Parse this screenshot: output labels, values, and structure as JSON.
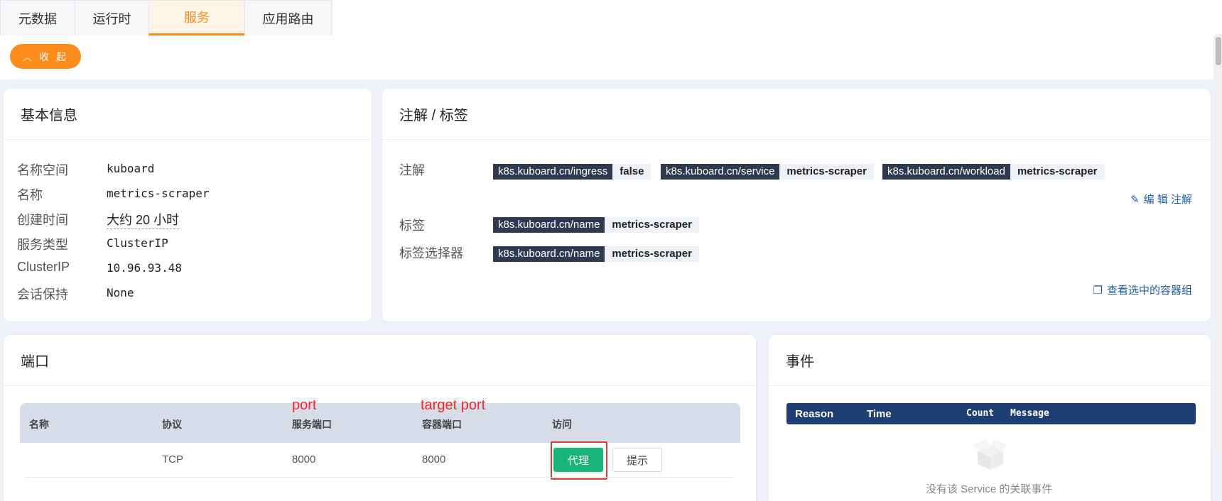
{
  "tabs": [
    {
      "label": "元数据"
    },
    {
      "label": "运行时"
    },
    {
      "label": "服务"
    },
    {
      "label": "应用路由"
    }
  ],
  "toolbar": {
    "collapse_label": "收 起",
    "collapse_icon": "chevron-up-icon"
  },
  "basic_info": {
    "title": "基本信息",
    "rows": [
      {
        "key": "名称空间",
        "value": "kuboard"
      },
      {
        "key": "名称",
        "value": "metrics-scraper"
      },
      {
        "key": "创建时间",
        "value": "大约 20 小时"
      },
      {
        "key": "服务类型",
        "value": "ClusterIP"
      },
      {
        "key": "ClusterIP",
        "value": "10.96.93.48"
      },
      {
        "key": "会话保持",
        "value": "None"
      }
    ]
  },
  "annotations": {
    "title": "注解 / 标签",
    "annotations_label": "注解",
    "labels_label": "标签",
    "selector_label": "标签选择器",
    "annotations": [
      {
        "key": "k8s.kuboard.cn/ingress",
        "value": "false"
      },
      {
        "key": "k8s.kuboard.cn/service",
        "value": "metrics-scraper"
      },
      {
        "key": "k8s.kuboard.cn/workload",
        "value": "metrics-scraper"
      }
    ],
    "labels": [
      {
        "key": "k8s.kuboard.cn/name",
        "value": "metrics-scraper"
      }
    ],
    "selectors": [
      {
        "key": "k8s.kuboard.cn/name",
        "value": "metrics-scraper"
      }
    ],
    "edit_link": "编 辑 注解",
    "view_pods_link": "查看选中的容器组"
  },
  "ports": {
    "title": "端口",
    "columns": [
      "名称",
      "协议",
      "服务端口",
      "容器端口",
      "访问"
    ],
    "rows": [
      {
        "name": "",
        "protocol": "TCP",
        "port": "8000",
        "target_port": "8000"
      }
    ],
    "proxy_label": "代理",
    "hint_label": "提示",
    "annotation_port": "port",
    "annotation_target_port": "target port"
  },
  "events": {
    "title": "事件",
    "columns": [
      "Reason",
      "Time",
      "Count",
      "Message"
    ],
    "empty_text": "没有该 Service 的关联事件"
  },
  "colors": {
    "accent": "#ff8c1a",
    "tag_key_bg": "#2e3a4f",
    "events_header": "#1f3f73",
    "proxy_button": "#19b47a",
    "annotation_red": "#e53935"
  }
}
